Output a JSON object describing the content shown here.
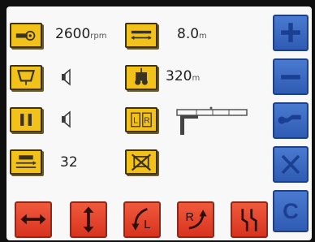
{
  "status": {
    "rpm_value": "2600",
    "rpm_unit": "rpm",
    "width_value": "8.0",
    "width_unit": "m",
    "area_value": "320",
    "area_unit": "m",
    "counter_value": "32"
  },
  "icons": {
    "rpm": "pto-rpm-icon",
    "width": "working-width-icon",
    "hopper": "hopper-icon",
    "speaker1": "speaker-icon",
    "tractor": "tractor-distance-icon",
    "pause": "pause-icon",
    "speaker2": "speaker-icon",
    "lr": "left-right-section-icon",
    "lift": "lift-position-icon",
    "counter": "seed-counter-icon",
    "disabled": "disabled-function-icon"
  },
  "right_buttons": [
    "plus",
    "minus",
    "wrench",
    "close",
    "c"
  ],
  "right_c_label": "C",
  "lr_labels": {
    "left": "L",
    "right": "R"
  },
  "bottom_buttons": [
    "horizontal-arrows",
    "vertical-arrows",
    "turn-left",
    "turn-right",
    "marker-switch"
  ],
  "bottom_labels": {
    "turn_left": "L",
    "turn_right": "R"
  },
  "colors": {
    "tile_yellow": "#f2c21b",
    "blue_button": "#3a6ac4",
    "red_button": "#e1452b"
  }
}
